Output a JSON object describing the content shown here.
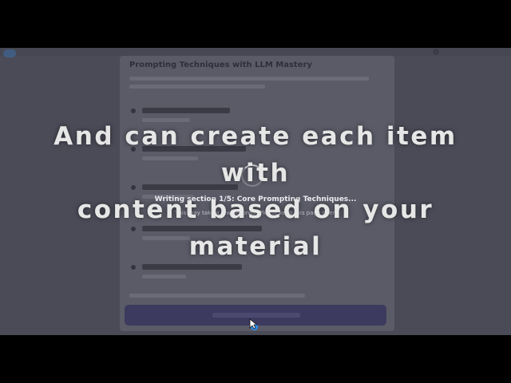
{
  "overlay_caption": {
    "lines": [
      "And can create each item",
      "with",
      "content based on your",
      "material"
    ]
  },
  "progress": {
    "status": "Writing section 1/5: Core Prompting Techniques...",
    "note": "This may take a few seconds. Please keep this page open"
  },
  "outline": {
    "title": "Prompting Techniques with LLM Mastery"
  },
  "colors": {
    "frame_background": "#4a4b57",
    "panel_background": "#5a5b67",
    "generate_button": "#3d3a5f",
    "cursor_click_highlight": "#2b8ef0",
    "caption_text": "#e6e6e6"
  },
  "icons": {
    "spinner": "loading-spinner-icon",
    "cursor": "mouse-pointer-icon"
  }
}
